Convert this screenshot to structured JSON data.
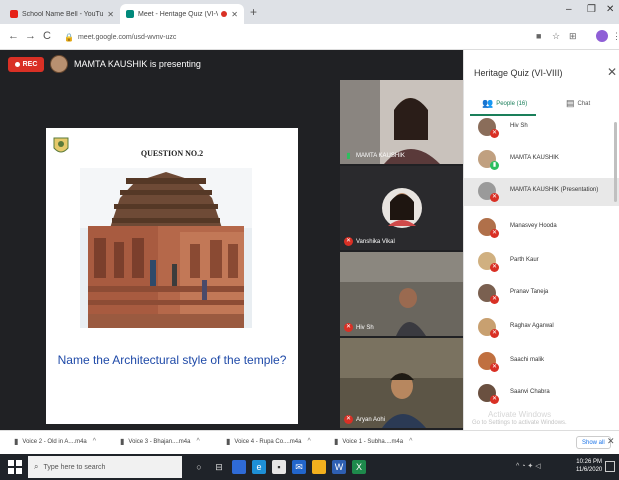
{
  "browser": {
    "tabs": [
      {
        "title": "School Name Bell - YouTube",
        "active": false
      },
      {
        "title": "Meet - Heritage Quiz (VI-VII)",
        "active": true
      }
    ],
    "url": "meet.google.com/usd-wvnv-uzc"
  },
  "meet": {
    "rec_label": "REC",
    "presenting_text": "MAMTA KAUSHIK is presenting",
    "slide": {
      "question_number": "QUESTION NO.2",
      "question": "Name the Architectural style of the temple?"
    },
    "tiles": [
      {
        "name": "MAMTA KAUSHIK",
        "mic": "on"
      },
      {
        "name": "Vanshika Vikal",
        "mic": "off"
      },
      {
        "name": "Hiv Sh",
        "mic": "off"
      },
      {
        "name": "Aryan Aohi",
        "mic": "off"
      }
    ]
  },
  "panel": {
    "title": "Heritage Quiz (VI-VIII)",
    "tab_people": "People (16)",
    "tab_chat": "Chat",
    "participants": [
      {
        "name": "Hiv Sh",
        "color": "#8a6d5a"
      },
      {
        "name": "MAMTA KAUSHIK",
        "color": "#c0a080"
      },
      {
        "name": "MAMTA KAUSHIK (Presentation)",
        "color": "#9a9a9a"
      },
      {
        "name": "Manasvey Hooda",
        "color": "#b0704a"
      },
      {
        "name": "Parth Kaur",
        "color": "#d0b080"
      },
      {
        "name": "Pranav Taneja",
        "color": "#7a6050"
      },
      {
        "name": "Raghav Agarwal",
        "color": "#c8a070"
      },
      {
        "name": "Saachi malik",
        "color": "#c07040"
      },
      {
        "name": "Saanvi Chabra",
        "color": "#6a5040"
      }
    ]
  },
  "downloads": [
    {
      "name": "Voice 2 - Old in A....m4a"
    },
    {
      "name": "Voice 3 - Bhajan....m4a"
    },
    {
      "name": "Voice 4 - Rupa Co....m4a"
    },
    {
      "name": "Voice 1 - Subha....m4a"
    }
  ],
  "downloads_show_all": "Show all",
  "watermark": {
    "line1": "Activate Windows",
    "line2": "Go to Settings to activate Windows."
  },
  "taskbar": {
    "search_placeholder": "Type here to search",
    "time": "10:26 PM",
    "date": "11/6/2020"
  }
}
